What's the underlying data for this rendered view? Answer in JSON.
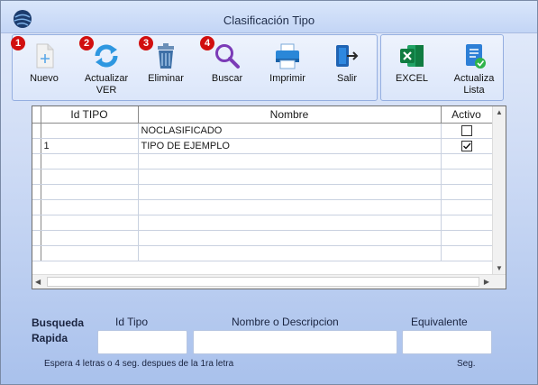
{
  "window": {
    "title": "Clasificación Tipo"
  },
  "toolbar": {
    "buttons": [
      {
        "label": "Nuevo",
        "badge": "1",
        "icon": "add-file-icon"
      },
      {
        "label": "Actualizar\nVER",
        "badge": "2",
        "icon": "refresh-icon"
      },
      {
        "label": "Eliminar",
        "badge": "3",
        "icon": "trash-icon"
      },
      {
        "label": "Buscar",
        "badge": "4",
        "icon": "search-icon"
      },
      {
        "label": "Imprimir",
        "icon": "printer-icon"
      },
      {
        "label": "Salir",
        "icon": "exit-icon"
      }
    ],
    "secondary": [
      {
        "label": "EXCEL",
        "icon": "excel-icon"
      },
      {
        "label": "Actualiza\nLista",
        "icon": "update-list-icon"
      }
    ]
  },
  "grid": {
    "columns": [
      "Id TIPO",
      "Nombre",
      "Activo"
    ],
    "rows": [
      {
        "id": "",
        "nombre": "NOCLASIFICADO",
        "activo": false
      },
      {
        "id": "1",
        "nombre": "TIPO DE EJEMPLO",
        "activo": true
      }
    ]
  },
  "search": {
    "title_line1": "Busqueda",
    "title_line2": "Rapida",
    "id_label": "Id Tipo",
    "name_label": "Nombre o Descripcion",
    "equiv_label": "Equivalente",
    "id_value": "",
    "name_value": "",
    "equiv_value": "",
    "hint": "Espera 4 letras o 4 seg. despues de la 1ra letra",
    "seg_label": "Seg."
  },
  "colors": {
    "badge": "#d10f0f",
    "accent": "#1e88e5"
  }
}
